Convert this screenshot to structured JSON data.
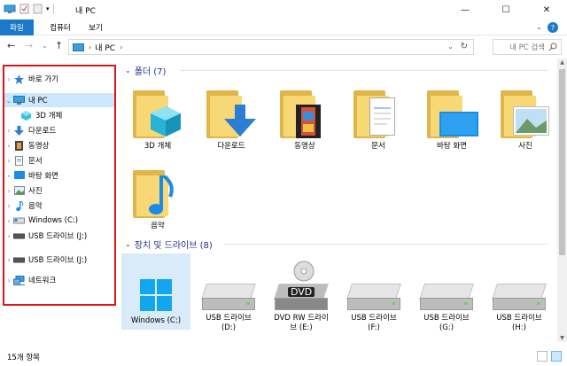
{
  "window": {
    "title": "내 PC",
    "controls": {
      "minimize": "—",
      "maximize": "☐",
      "close": "✕"
    }
  },
  "ribbon": {
    "tabs": [
      "파일",
      "컴퓨터",
      "보기"
    ],
    "help": "?"
  },
  "navigation": {
    "back": "←",
    "forward": "→",
    "dropdown": "⌄",
    "up": "↑",
    "address_crumb": "내 PC",
    "search_placeholder": "내 PC 검색"
  },
  "sidebar": {
    "items": [
      {
        "label": "바로 가기",
        "icon": "star-icon",
        "color": "#2b80d4"
      },
      {
        "label": "내 PC",
        "icon": "pc-icon",
        "color": "#3aa0e0"
      },
      {
        "label": "3D 개체",
        "icon": "cube-icon",
        "color": "#38c0e0"
      },
      {
        "label": "다운로드",
        "icon": "download-icon",
        "color": "#2a7fd4"
      },
      {
        "label": "동영상",
        "icon": "video-icon",
        "color": "#555555"
      },
      {
        "label": "문서",
        "icon": "document-icon",
        "color": "#8a8a8a"
      },
      {
        "label": "바탕 화면",
        "icon": "desktop-icon",
        "color": "#1a8ce8"
      },
      {
        "label": "사진",
        "icon": "pictures-icon",
        "color": "#5a9a5a"
      },
      {
        "label": "음악",
        "icon": "music-icon",
        "color": "#1a8ce8"
      },
      {
        "label": "Windows (C:)",
        "icon": "windows-drive-icon",
        "color": "#808080"
      },
      {
        "label": "USB 드라이브 (J:)",
        "icon": "usb-drive-icon",
        "color": "#606060"
      },
      {
        "label": "USB 드라이브 (J:)",
        "icon": "usb-drive-icon",
        "color": "#606060"
      },
      {
        "label": "네트워크",
        "icon": "network-icon",
        "color": "#3aa0e0"
      }
    ]
  },
  "main": {
    "folders_group": "폴더 (7)",
    "drives_group": "장치 및 드라이브 (8)",
    "folders": [
      {
        "label": "3D 개체",
        "overlay": "cube"
      },
      {
        "label": "다운로드",
        "overlay": "arrow"
      },
      {
        "label": "동영상",
        "overlay": "film"
      },
      {
        "label": "문서",
        "overlay": "doc"
      },
      {
        "label": "바탕 화면",
        "overlay": "screen"
      },
      {
        "label": "사진",
        "overlay": "photo"
      },
      {
        "label": "음악",
        "overlay": "note"
      }
    ],
    "drives": [
      {
        "label": "Windows (C:)",
        "kind": "windows"
      },
      {
        "label": "USB 드라이브\n(D:)",
        "kind": "hdd"
      },
      {
        "label": "DVD RW 드라이\n브 (E:)",
        "kind": "dvd",
        "badge": "DVD"
      },
      {
        "label": "USB 드라이브\n(F:)",
        "kind": "hdd"
      },
      {
        "label": "USB 드라이브\n(G:)",
        "kind": "hdd"
      },
      {
        "label": "USB 드라이브\n(H:)",
        "kind": "hdd"
      }
    ]
  },
  "status": {
    "count": "15개 항목"
  },
  "colors": {
    "accent": "#1979ca",
    "selection": "#cce8ff",
    "highlight_border": "#e0141a",
    "group_title": "#1e3287"
  }
}
